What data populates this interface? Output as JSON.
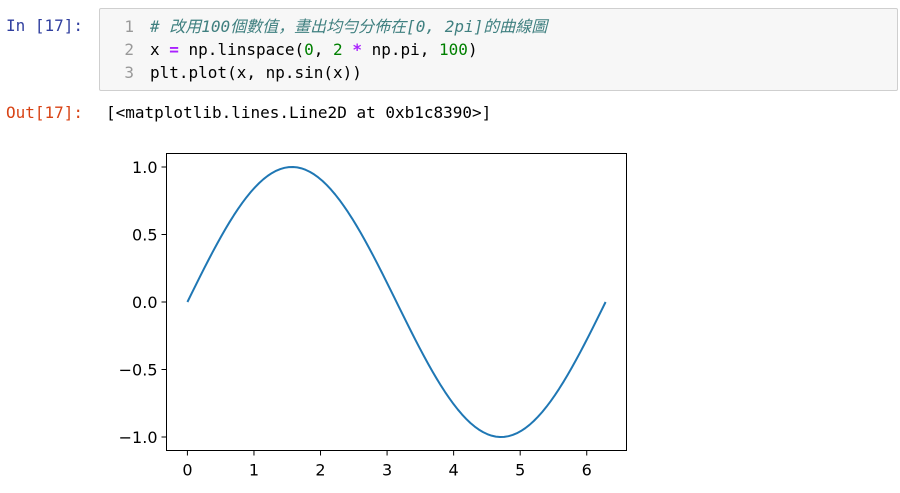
{
  "input_cell": {
    "prompt": "In [17]:",
    "lines": [
      {
        "number": "1",
        "parts": [
          {
            "kind": "comment",
            "text": "# 改用100個數值，畫出均勻分佈在[0, 2pi]的曲線圖"
          }
        ]
      },
      {
        "number": "2",
        "parts": [
          {
            "kind": "text",
            "text": "x "
          },
          {
            "kind": "op",
            "text": "="
          },
          {
            "kind": "text",
            "text": " np.linspace("
          },
          {
            "kind": "num",
            "text": "0"
          },
          {
            "kind": "text",
            "text": ", "
          },
          {
            "kind": "num",
            "text": "2"
          },
          {
            "kind": "text",
            "text": " "
          },
          {
            "kind": "op",
            "text": "*"
          },
          {
            "kind": "text",
            "text": " np.pi, "
          },
          {
            "kind": "num",
            "text": "100"
          },
          {
            "kind": "text",
            "text": ")"
          }
        ]
      },
      {
        "number": "3",
        "parts": [
          {
            "kind": "text",
            "text": "plt.plot(x, np.sin(x))"
          }
        ]
      }
    ]
  },
  "output_cell": {
    "prompt": "Out[17]:",
    "text": "[<matplotlib.lines.Line2D at 0xb1c8390>]"
  },
  "colors": {
    "line": "#1f77b4",
    "prompt_in": "#303f9f",
    "prompt_out": "#d84315",
    "comment": "#408080",
    "number": "#008000",
    "operator": "#aa22ff"
  },
  "chart_data": {
    "type": "line",
    "function": "sin",
    "x_range": [
      0,
      6.283185307179586
    ],
    "num_points": 100,
    "xlim": [
      -0.3141592653589793,
      6.5973445725385655
    ],
    "ylim": [
      -1.0999,
      1.0999
    ],
    "x_ticks": [
      0,
      1,
      2,
      3,
      4,
      5,
      6
    ],
    "x_tick_labels": [
      "0",
      "1",
      "2",
      "3",
      "4",
      "5",
      "6"
    ],
    "y_ticks": [
      1.0,
      0.5,
      0.0,
      -0.5,
      -1.0
    ],
    "y_tick_labels": [
      "1.0",
      "0.5",
      "0.0",
      "−0.5",
      "−1.0"
    ],
    "series": [
      {
        "color": "#1f77b4"
      }
    ],
    "grid": false,
    "title": "",
    "xlabel": "",
    "ylabel": ""
  }
}
